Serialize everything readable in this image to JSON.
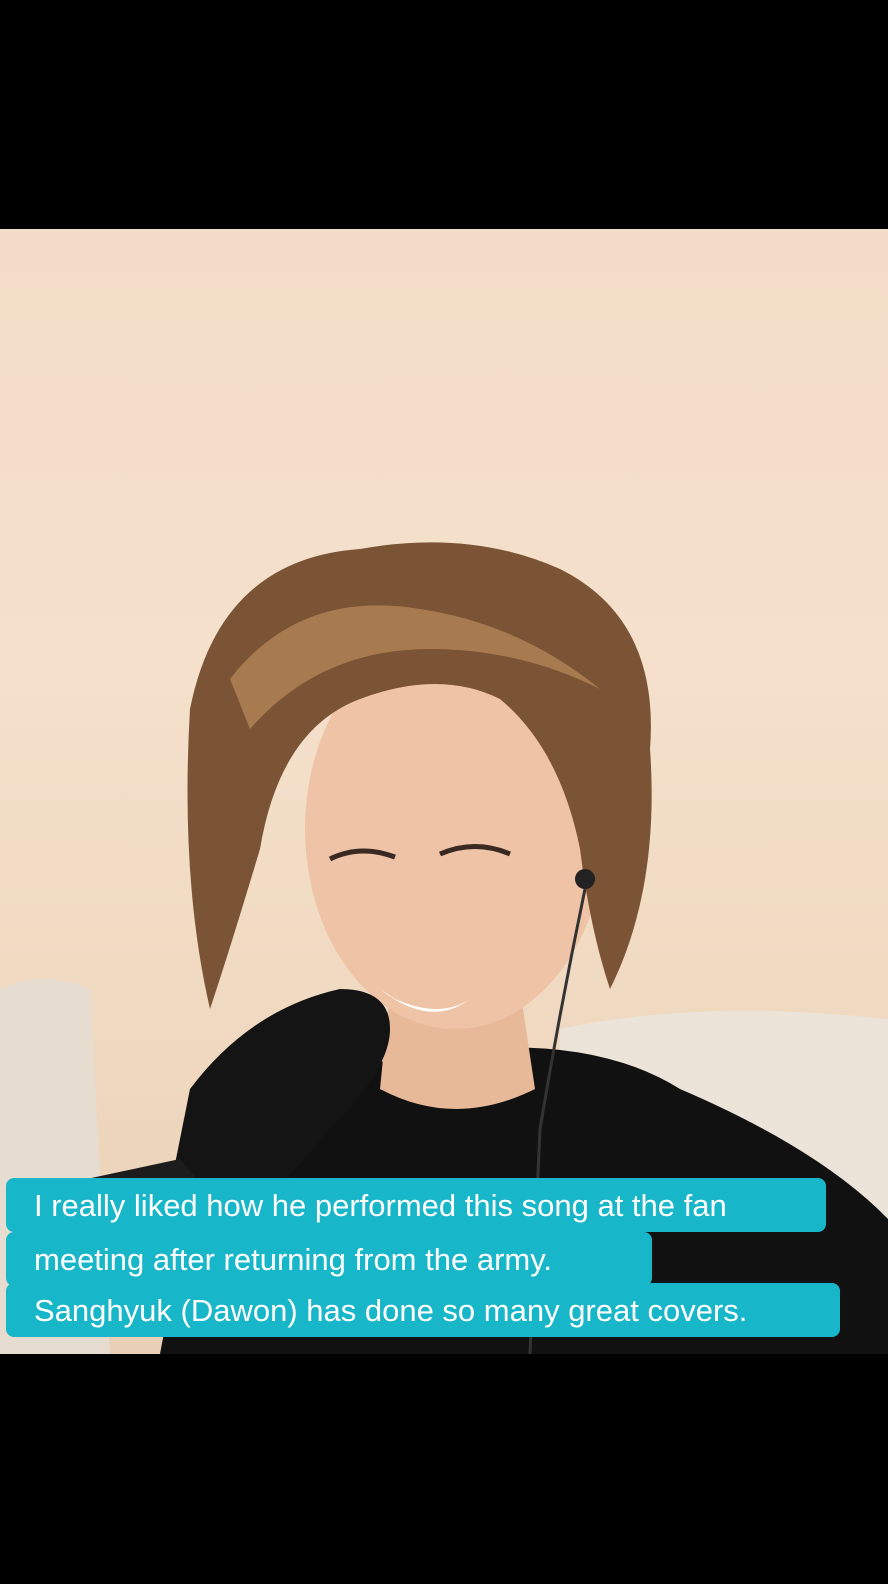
{
  "video": {
    "icon": "person-singing-into-microphone"
  },
  "caption": {
    "line1": "I really liked how he performed this song at the fan",
    "line2": "meeting after returning from the army.",
    "line3": "Sanghyuk (Dawon) has done so many great covers."
  },
  "colors": {
    "caption_background": "#17b6c9",
    "caption_text": "#ffffff",
    "letterbox": "#000000",
    "wall": "#f3ddc8"
  }
}
